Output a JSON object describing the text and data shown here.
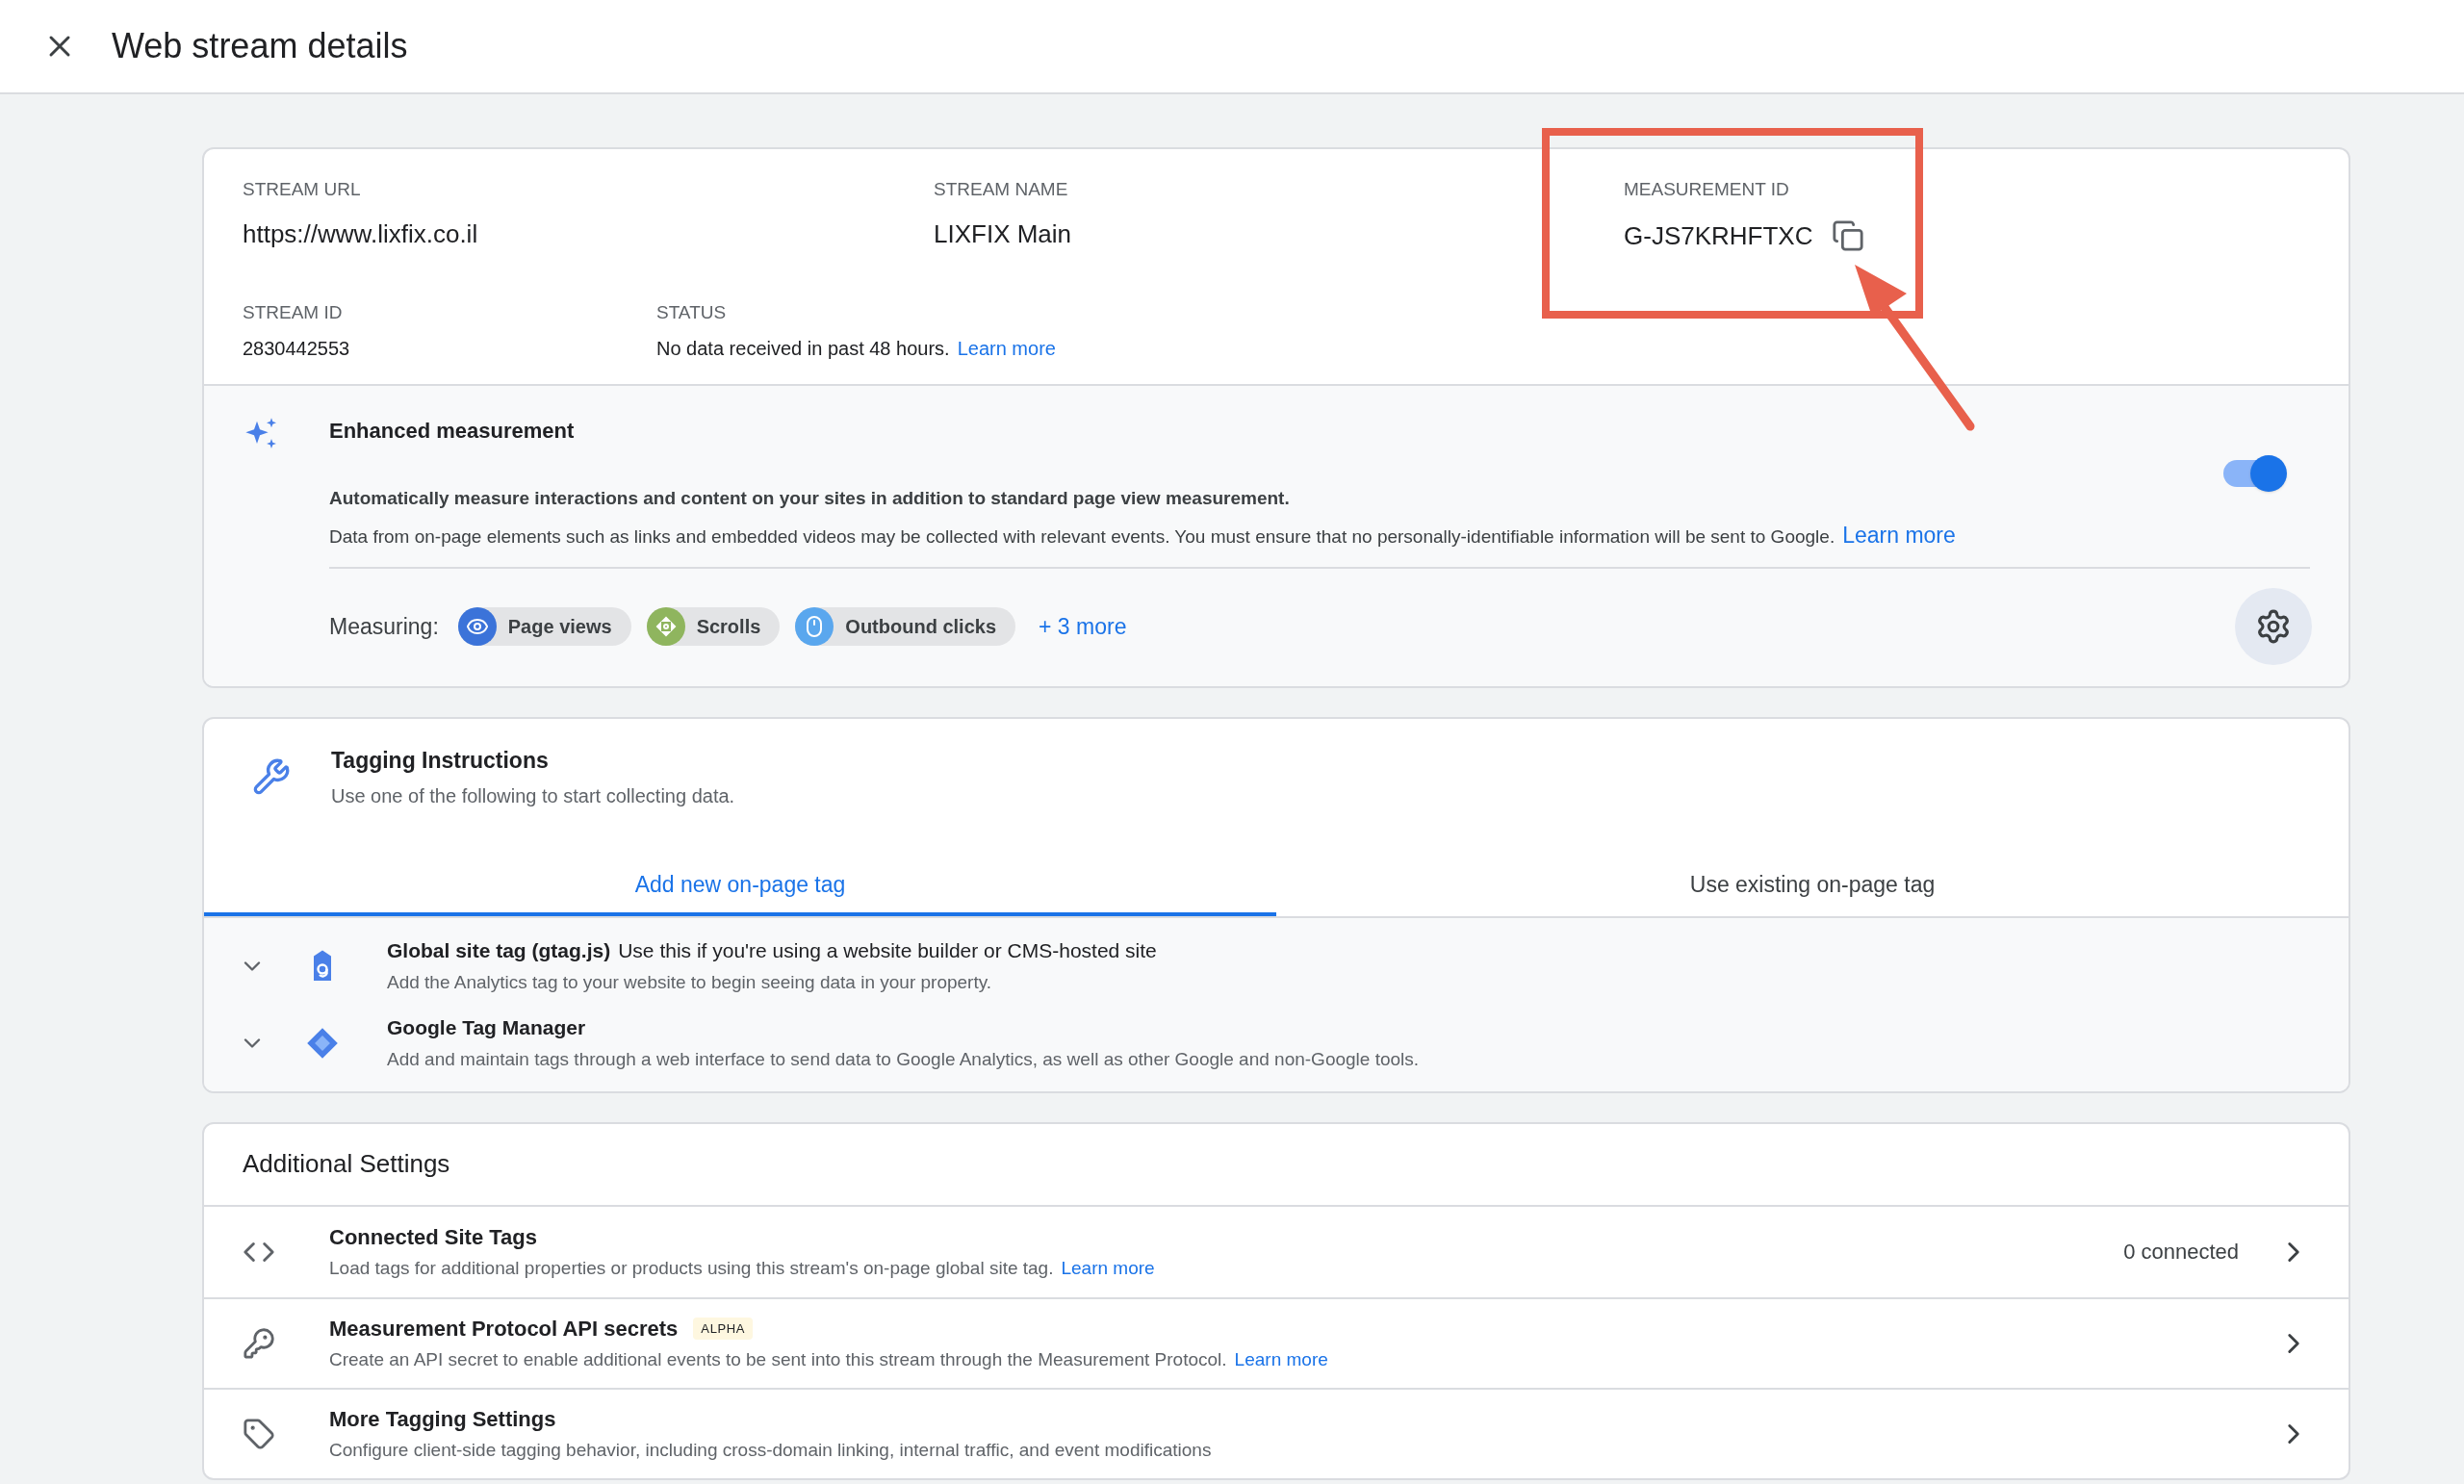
{
  "header": {
    "title": "Web stream details"
  },
  "stream": {
    "fields": [
      {
        "label": "STREAM URL",
        "value": "https://www.lixfix.co.il"
      },
      {
        "label": "STREAM NAME",
        "value": "LIXFIX Main"
      },
      {
        "label": "MEASUREMENT ID",
        "value": "G-JS7KRHFTXC"
      }
    ],
    "details": [
      {
        "label": "STREAM ID",
        "value": "2830442553"
      },
      {
        "label": "STATUS",
        "value": "No data received in past 48 hours.",
        "link": "Learn more"
      }
    ]
  },
  "enhanced": {
    "title": "Enhanced measurement",
    "on": true,
    "line1": "Automatically measure interactions and content on your sites in addition to standard page view measurement.",
    "line2": "Data from on-page elements such as links and embedded videos may be collected with relevant events. You must ensure that no personally-identifiable information will be sent to Google.",
    "link": "Learn more",
    "measuring_label": "Measuring:",
    "chips": [
      {
        "kind": "eye",
        "label": "Page views",
        "color": "#3b73d9"
      },
      {
        "kind": "scroll",
        "label": "Scrolls",
        "color": "#8fb55e"
      },
      {
        "kind": "mouse",
        "label": "Outbound clicks",
        "color": "#5aa7ee"
      }
    ],
    "more": "+ 3 more"
  },
  "tagging": {
    "title": "Tagging Instructions",
    "subtitle": "Use one of the following to start collecting data.",
    "tabs": [
      {
        "label": "Add new on-page tag",
        "selected": true
      },
      {
        "label": "Use existing on-page tag",
        "selected": false
      }
    ],
    "options": [
      {
        "kind": "gtag",
        "title": "Global site tag (gtag.js)",
        "note": "Use this if you're using a website builder or CMS-hosted site",
        "description": "Add the Analytics tag to your website to begin seeing data in your property.",
        "expanded": false
      },
      {
        "kind": "gtm",
        "title": "Google Tag Manager",
        "description": "Add and maintain tags through a web interface to send data to Google Analytics, as well as other Google and non-Google tools.",
        "expanded": false
      }
    ]
  },
  "additional": {
    "title": "Additional Settings",
    "rows": [
      {
        "kind": "code",
        "title": "Connected Site Tags",
        "description": "Load tags for additional properties or products using this stream's on-page global site tag.",
        "link": "Learn more",
        "value": "0 connected"
      },
      {
        "kind": "key",
        "title": "Measurement Protocol API secrets",
        "badge": "ALPHA",
        "description": "Create an API secret to enable additional events to be sent into this stream through the Measurement Protocol.",
        "link": "Learn more"
      },
      {
        "kind": "label",
        "title": "More Tagging Settings",
        "description": "Configure client-side tagging behavior, including cross-domain linking, internal traffic, and event modifications"
      }
    ]
  }
}
